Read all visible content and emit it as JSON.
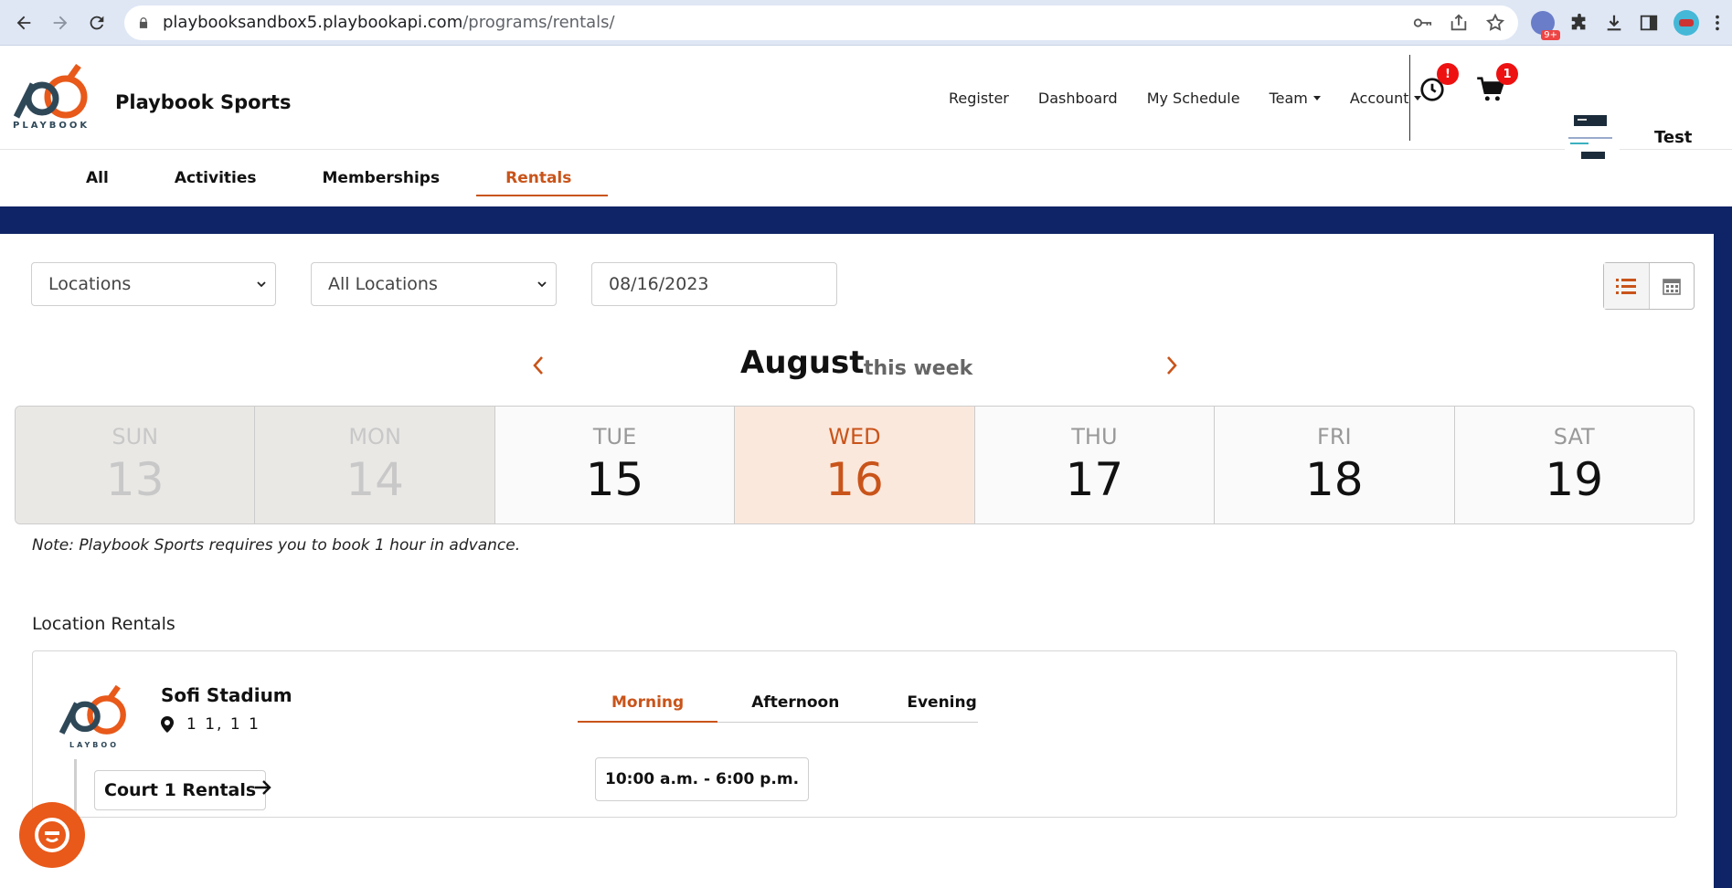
{
  "browser": {
    "url_host": "playbooksandbox5.playbookapi.com",
    "url_path": "/programs/rentals/",
    "ext_badge": "9+"
  },
  "header": {
    "brand": "Playbook Sports",
    "logo_text": "PLAYBOOK",
    "nav": [
      {
        "label": "Register"
      },
      {
        "label": "Dashboard"
      },
      {
        "label": "My Schedule"
      },
      {
        "label": "Team"
      },
      {
        "label": "Account"
      }
    ],
    "history_badge": "!",
    "cart_badge": "1",
    "user_name": "Test"
  },
  "category_tabs": [
    {
      "label": "All"
    },
    {
      "label": "Activities"
    },
    {
      "label": "Memberships"
    },
    {
      "label": "Rentals",
      "active": true
    }
  ],
  "filters": {
    "type_select": "Locations",
    "location_select": "All Locations",
    "date": "08/16/2023"
  },
  "week": {
    "month": "August",
    "label": "this week",
    "days": [
      {
        "name": "SUN",
        "num": "13"
      },
      {
        "name": "MON",
        "num": "14"
      },
      {
        "name": "TUE",
        "num": "15"
      },
      {
        "name": "WED",
        "num": "16"
      },
      {
        "name": "THU",
        "num": "17"
      },
      {
        "name": "FRI",
        "num": "18"
      },
      {
        "name": "SAT",
        "num": "19"
      }
    ]
  },
  "note": "Note: Playbook Sports requires you to book 1 hour in advance.",
  "rentals": {
    "section_title": "Location Rentals",
    "venue": "Sofi Stadium",
    "location": "1 1, 1 1",
    "logo_text": "LAYBOO",
    "court": "Court 1 Rentals",
    "time_tabs": [
      "Morning",
      "Afternoon",
      "Evening"
    ],
    "slot": "10:00 a.m. - 6:00 p.m."
  },
  "colors": {
    "accent": "#c9541a",
    "navy": "#0f2466",
    "logo_dark": "#2f4858",
    "logo_orange": "#e8591a"
  }
}
